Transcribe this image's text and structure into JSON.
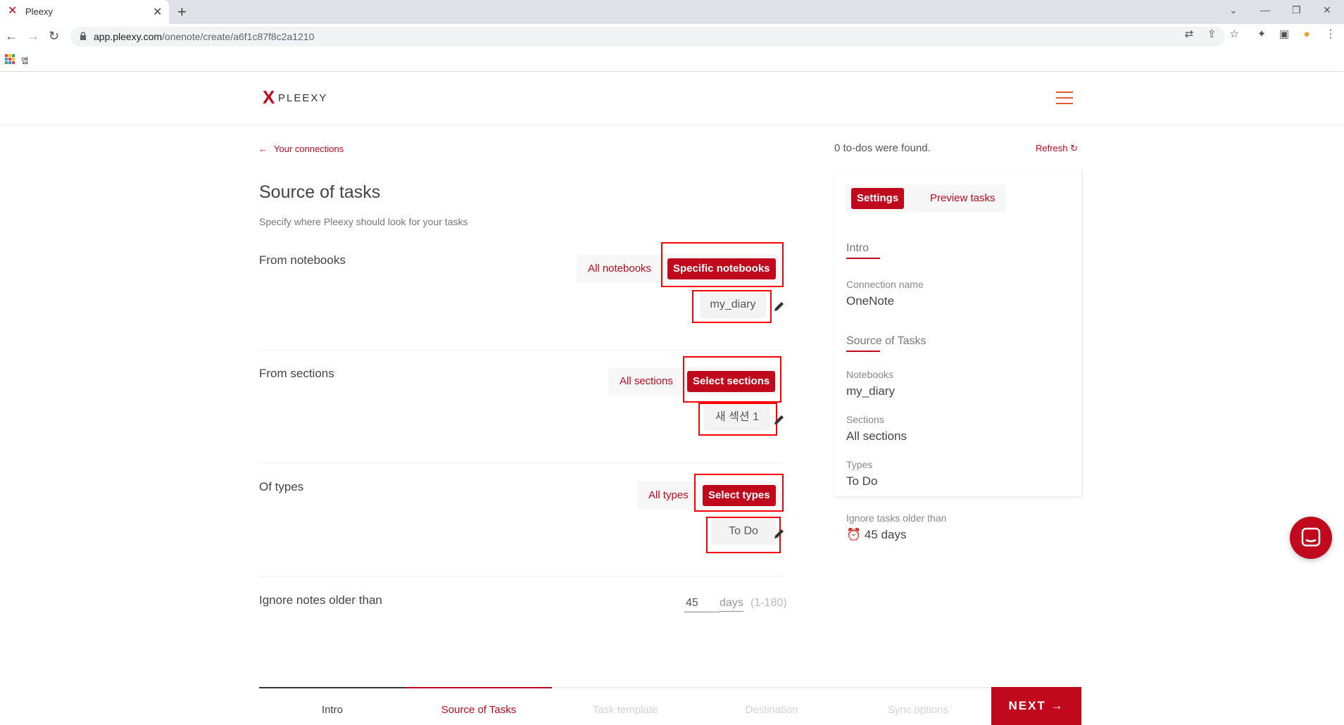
{
  "browser": {
    "tab_title": "Pleexy",
    "url_domain": "app.pleexy.com",
    "url_path": "/onenote/create/a6f1c87f8c2a1210",
    "bookmark_label": "앱"
  },
  "header": {
    "logo_text": "PLEEXY"
  },
  "main": {
    "back_link": "Your connections",
    "title": "Source of tasks",
    "subtitle": "Specify where Pleexy should look for your tasks",
    "notebooks": {
      "label": "From notebooks",
      "option_all": "All notebooks",
      "option_specific": "Specific notebooks",
      "selected_value": "my_diary"
    },
    "sections": {
      "label": "From sections",
      "option_all": "All sections",
      "option_select": "Select sections",
      "selected_value": "새 섹션 1"
    },
    "types": {
      "label": "Of types",
      "option_all": "All types",
      "option_select": "Select types",
      "selected_value": "To Do"
    },
    "ignore": {
      "label": "Ignore notes older than",
      "value": "45",
      "unit": "days",
      "range": "(1-180)"
    }
  },
  "panel": {
    "todos_found": "0 to-dos were found.",
    "refresh": "Refresh",
    "tab_settings": "Settings",
    "tab_preview": "Preview tasks",
    "section_intro": "Intro",
    "connection_name_label": "Connection name",
    "connection_name_value": "OneNote",
    "section_source": "Source of Tasks",
    "notebooks_label": "Notebooks",
    "notebooks_value": "my_diary",
    "sections_label": "Sections",
    "sections_value": "All sections",
    "types_label": "Types",
    "types_value": "To Do",
    "ignore_label": "Ignore tasks older than",
    "ignore_value": "45 days"
  },
  "stepper": {
    "steps": [
      "Intro",
      "Source of Tasks",
      "Task template",
      "Destination",
      "Sync options"
    ],
    "next_label": "NEXT"
  },
  "colors": {
    "accent": "#c0091c",
    "highlight": "#ff0000",
    "menu": "#e25d2b"
  }
}
